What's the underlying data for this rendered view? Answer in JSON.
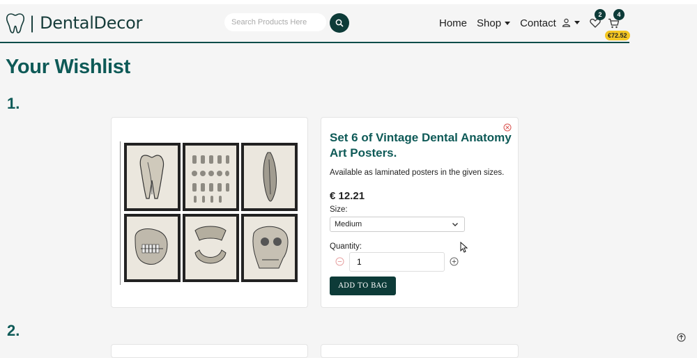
{
  "brand": {
    "text": "| DentalDecor",
    "logo_icon": "tooth-icon"
  },
  "search": {
    "placeholder": "Search Products Here",
    "icon": "search-icon"
  },
  "nav": {
    "home": "Home",
    "shop": "Shop",
    "contact": "Contact"
  },
  "header_icons": {
    "wishlist_count": "2",
    "cart_count": "4",
    "cart_total": "€72.52"
  },
  "page": {
    "title": "Your Wishlist"
  },
  "items": [
    {
      "number": "1.",
      "title": "Set 6 of Vintage Dental Anatomy Art Posters.",
      "description": "Available as laminated posters in the given sizes.",
      "price": "€ 12.21",
      "size_label": "Size:",
      "size_value": "Medium",
      "quantity_label": "Quantity:",
      "quantity_value": "1",
      "add_button": "ADD TO BAG"
    },
    {
      "number": "2."
    }
  ],
  "colors": {
    "accent": "#0e5a57",
    "dark_button": "#0d3b38",
    "badge_yellow": "#f3c623",
    "background": "#f5f5f5"
  }
}
